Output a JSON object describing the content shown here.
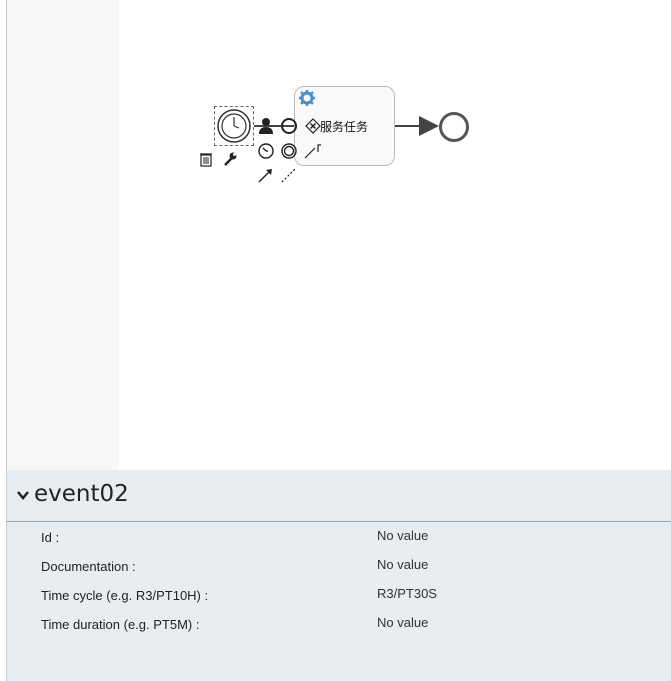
{
  "diagram": {
    "service_task_label": "服务任务",
    "timer_event_icon": "timer-icon",
    "end_event_icon": "end-event-circle"
  },
  "context_pad": {
    "icons": [
      "user-task-icon",
      "intermediate-event-icon",
      "gateway-icon",
      "delete-icon",
      "wrench-icon",
      "timer-small-icon",
      "end-event-small-icon",
      "text-annotation-icon",
      "sequence-flow-icon",
      "association-icon"
    ]
  },
  "properties": {
    "title": "event02",
    "rows": [
      {
        "label": "Id :",
        "value": "No value"
      },
      {
        "label": "Documentation :",
        "value": "No value"
      },
      {
        "label": "Time cycle (e.g. R3/PT10H) :",
        "value": "R3/PT30S"
      },
      {
        "label": "Time duration (e.g. PT5M) :",
        "value": "No value"
      }
    ]
  }
}
